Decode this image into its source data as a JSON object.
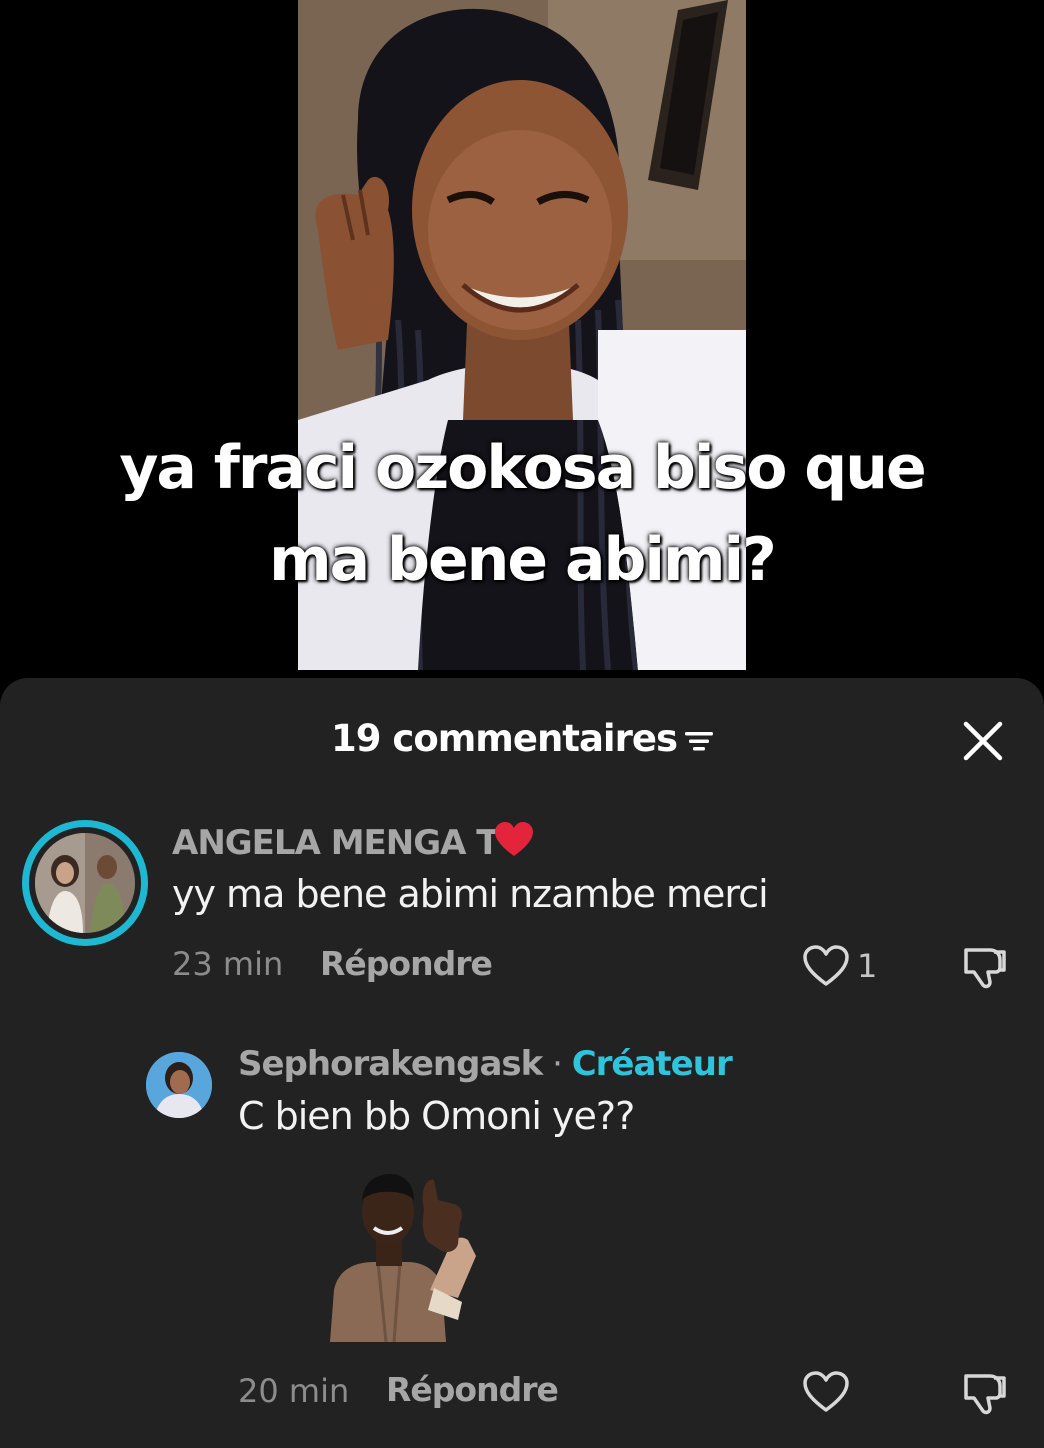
{
  "video": {
    "caption_line1": "ya fraci ozokosa biso que",
    "caption_line2": "ma bene abimi?"
  },
  "comments_panel": {
    "title": "19 commentaires",
    "sort_icon": "sort-lines-icon",
    "close_icon": "close-icon"
  },
  "comments": [
    {
      "username": "ANGELA MENGA T",
      "username_emoji": "red-heart",
      "text": "yy ma bene abimi nzambe merci",
      "time": "23 min",
      "reply_label": "Répondre",
      "likes": "1"
    },
    {
      "username": "Sephorakengask",
      "separator": " · ",
      "badge": "Créateur",
      "text": "C bien bb Omoni ye??",
      "sticker": "man-thumbs-up-sticker",
      "time": "20 min",
      "reply_label": "Répondre",
      "likes": ""
    }
  ],
  "colors": {
    "sheet_background": "#222222",
    "accent": "#2fc4dc",
    "text_secondary": "#a6a6a6"
  }
}
